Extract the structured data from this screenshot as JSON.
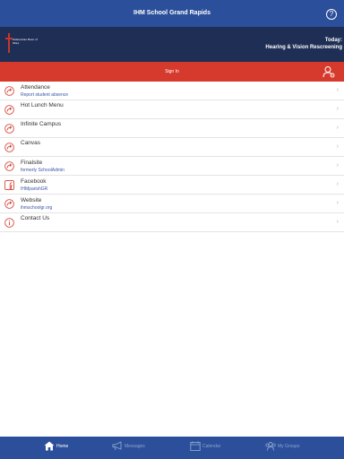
{
  "header": {
    "title": "IHM School Grand Rapids",
    "help_icon": "question-circle-icon"
  },
  "banner": {
    "logo_text": "Immaculate Heart of Mary",
    "today_label": "Today:",
    "today_value": "Hearing & Vision Rescreening"
  },
  "signin": {
    "label": "Sign In",
    "icon": "user-settings-icon"
  },
  "menu": [
    {
      "label": "Attendance",
      "sub": "Report student absence",
      "icon": "link-arrow-icon"
    },
    {
      "label": "Hot Lunch Menu",
      "sub": "",
      "icon": "link-arrow-icon"
    },
    {
      "label": "Infinite Campus",
      "sub": "",
      "icon": "link-arrow-icon"
    },
    {
      "label": "Canvas",
      "sub": "",
      "icon": "link-arrow-icon"
    },
    {
      "label": "Finalsite",
      "sub": "formerly SchoolAdmin",
      "icon": "link-arrow-icon"
    },
    {
      "label": "Facebook",
      "sub": "IHMparishGR",
      "icon": "facebook-icon"
    },
    {
      "label": "Website",
      "sub": "ihmschoolgr.org",
      "icon": "link-arrow-icon"
    },
    {
      "label": "Contact Us",
      "sub": "",
      "icon": "info-icon"
    }
  ],
  "tabs": {
    "home": "Home",
    "messages": "Messages",
    "calendar": "Calendar",
    "groups": "My Groups"
  },
  "colors": {
    "primary": "#2b4f9a",
    "banner": "#1e2e55",
    "accent": "#d63a2c"
  }
}
